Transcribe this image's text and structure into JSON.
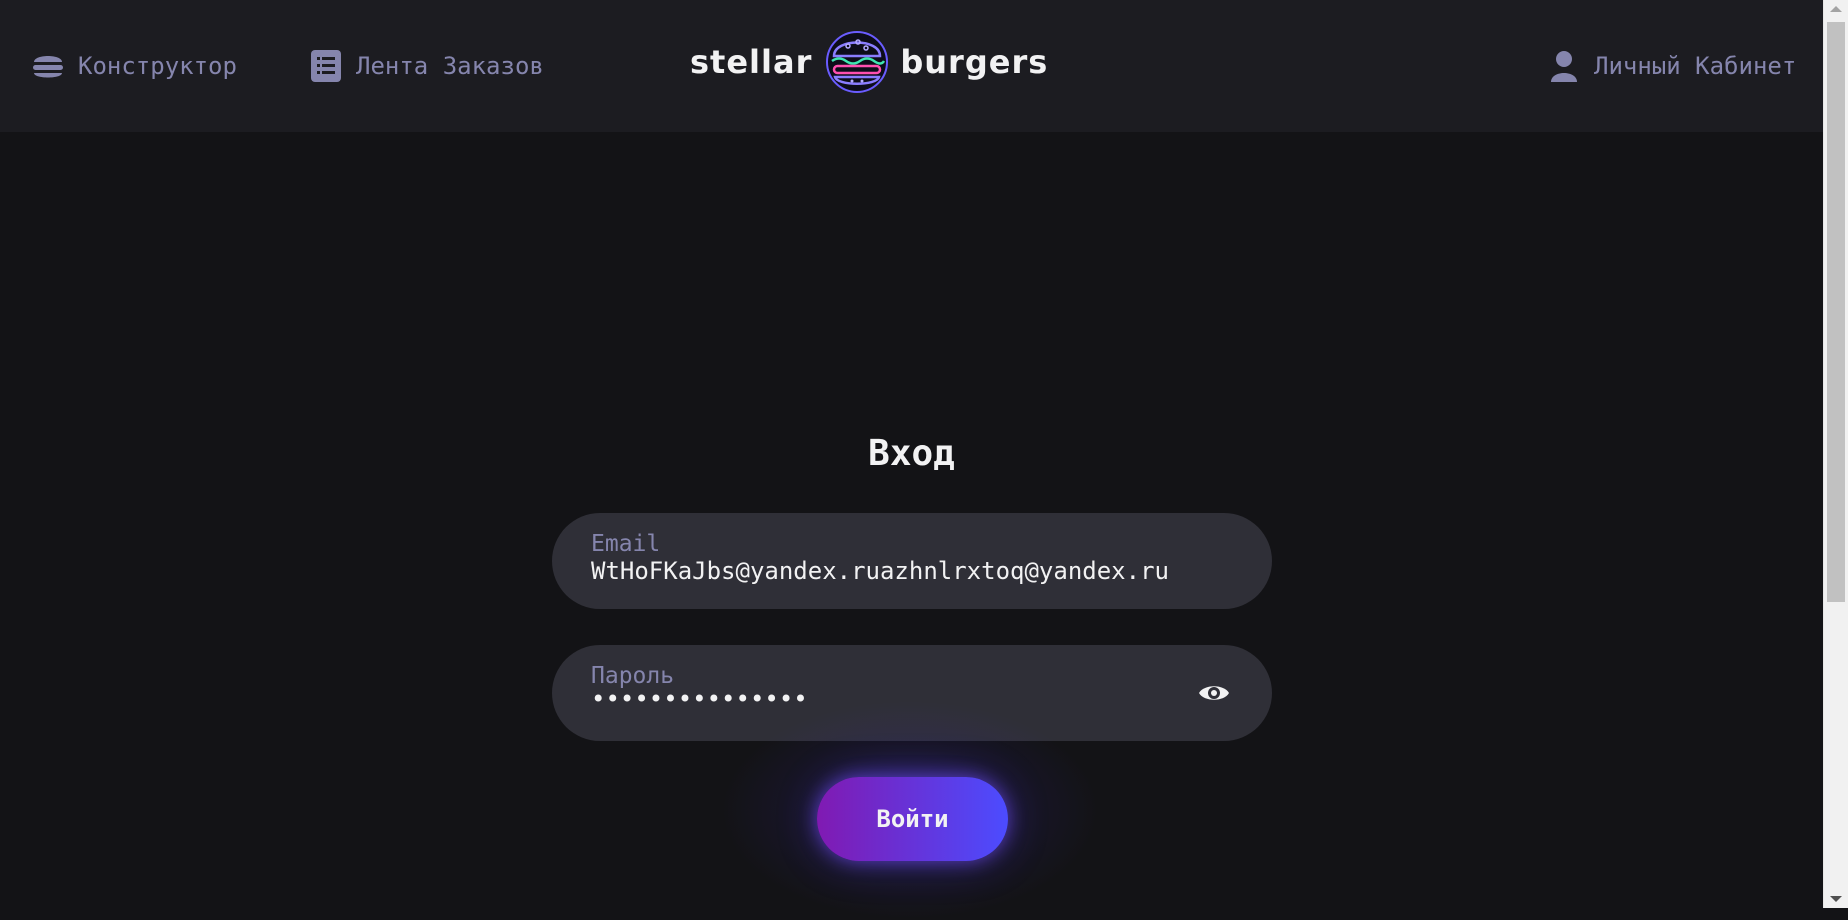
{
  "header": {
    "nav": {
      "constructor_label": "Конструктор",
      "feed_label": "Лента Заказов",
      "account_label": "Личный Кабинет"
    },
    "logo": {
      "left_word": "stellar",
      "right_word": "burgers"
    }
  },
  "login": {
    "title": "Вход",
    "email": {
      "label": "Email",
      "value": "WtHoFKaJbs@yandex.ruazhnlrxtoq@yandex.ru"
    },
    "password": {
      "label": "Пароль",
      "masked_value": "•••••••••••••••"
    },
    "submit_label": "Войти"
  },
  "colors": {
    "background": "#131316",
    "header_background": "#1c1c21",
    "field_background": "#2f2f37",
    "inactive_text": "#8585ad",
    "primary_text": "#f2f2f3",
    "button_gradient_start": "#801ab2",
    "button_gradient_end": "#4c4cff"
  }
}
